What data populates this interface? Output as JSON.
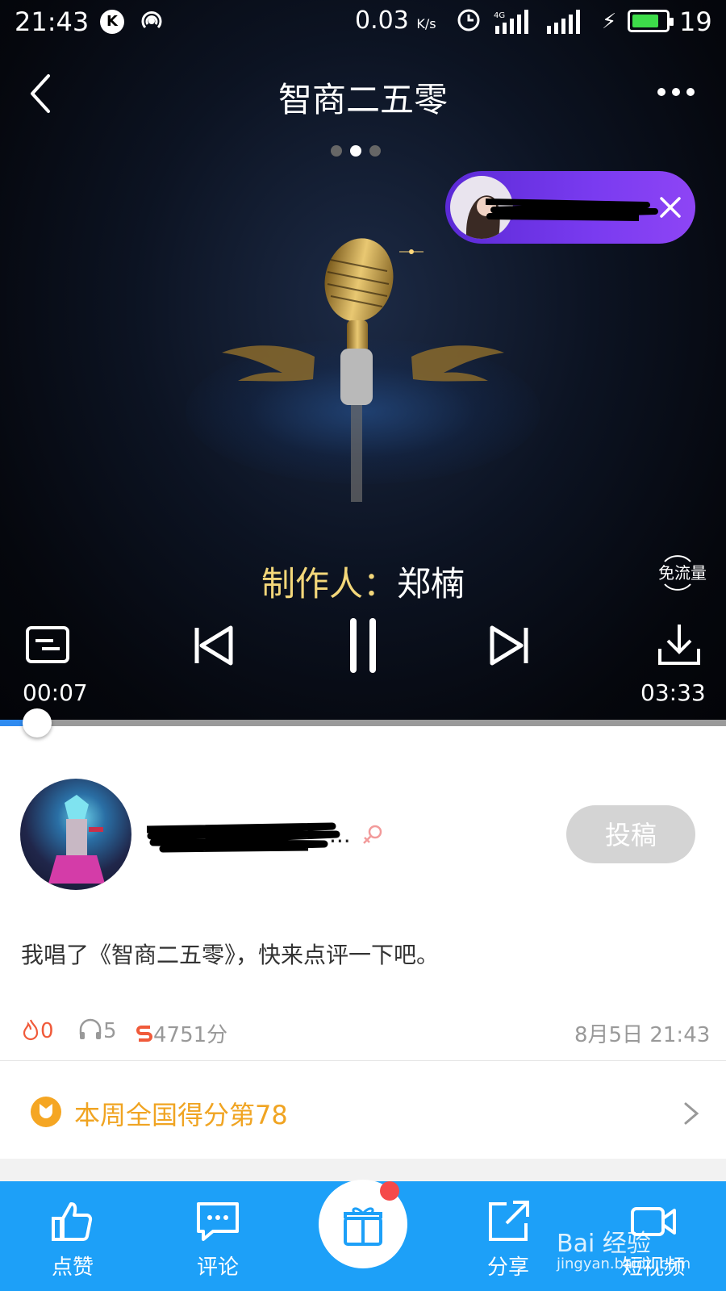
{
  "status_bar": {
    "time": "21:43",
    "app_badge": "K",
    "speed_value": "0.03",
    "speed_unit": "K/s",
    "network": "4G",
    "battery_percent": "19",
    "battery_level": 0.8
  },
  "header": {
    "title": "智商二五零",
    "page_count": 3,
    "active_page": 2
  },
  "player": {
    "producer_label": "制作人：",
    "producer_name": "郑楠",
    "free_data_label": "免流量",
    "current_time": "00:07",
    "total_time": "03:33",
    "progress": 0.035
  },
  "post": {
    "submit_label": "投稿",
    "username_suffix": "...",
    "caption": "我唱了《智商二五零》，快来点评一下吧。",
    "likes": "0",
    "listens": "5",
    "score": "4751分",
    "date": "8月5日 21:43"
  },
  "rank": {
    "text": "本周全国得分第78"
  },
  "tabbar": {
    "like": "点赞",
    "comment": "评论",
    "share": "分享",
    "video": "短视频"
  },
  "watermark": {
    "brand": "Bai 经验",
    "url": "jingyan.baidu.com"
  },
  "colors": {
    "accent_blue": "#1da0f8",
    "progress_blue": "#2f8bf0",
    "producer_gold": "#f3d77a",
    "rank_orange": "#f0a422",
    "pill_purple": "#6a33e6"
  }
}
